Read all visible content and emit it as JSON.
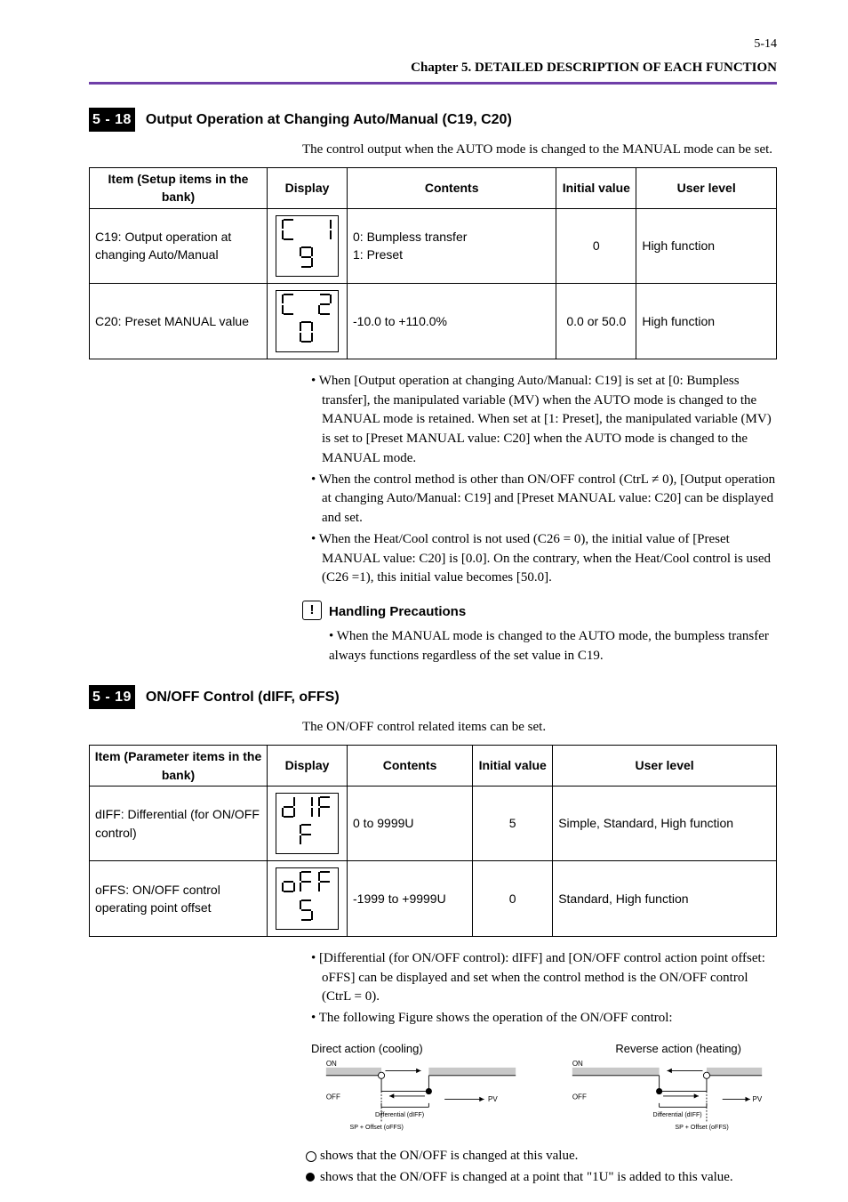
{
  "page_number": "5-14",
  "chapter": "Chapter 5.  DETAILED DESCRIPTION OF EACH FUNCTION",
  "section1": {
    "block": "5 - 18",
    "title": "Output Operation at Changing Auto/Manual (C19, C20)",
    "intro": "The control output when the AUTO mode is changed to the MANUAL mode can be set.",
    "th": [
      "Item (Setup items in the bank)",
      "Display",
      "Contents",
      "Initial value",
      "User level"
    ],
    "rows": [
      {
        "item": "C19: Output operation at changing Auto/Manual",
        "contents": "0: Bumpless transfer\n1: Preset",
        "init": "0",
        "user": "High function"
      },
      {
        "item": "C20: Preset MANUAL value",
        "contents": "-10.0 to +110.0%",
        "init": "0.0 or 50.0",
        "user": "High function"
      }
    ],
    "bullets": [
      "When [Output operation at changing Auto/Manual: C19] is set at [0: Bumpless transfer], the manipulated variable (MV) when the AUTO mode is changed to the MANUAL mode is retained. When set at [1: Preset], the manipulated variable (MV) is set to [Preset MANUAL value: C20] when the AUTO mode is changed to the MANUAL mode.",
      "When the control method is other than ON/OFF control (CtrL ≠ 0), [Output operation at changing Auto/Manual: C19] and [Preset MANUAL value: C20] can be displayed and set.",
      "When the Heat/Cool control is not used (C26 = 0), the initial value of [Preset MANUAL value: C20] is [0.0].  On the contrary, when the Heat/Cool control is used (C26 =1), this initial value becomes [50.0]."
    ],
    "note_label": "Handling Precautions",
    "note_body": "• When the MANUAL mode is changed to the AUTO mode, the bumpless transfer always functions regardless of the set value in C19."
  },
  "section2": {
    "block": "5 - 19",
    "title": "ON/OFF Control (dIFF, oFFS)",
    "intro": "The ON/OFF control related items can be set.",
    "th": [
      "Item (Parameter items in the bank)",
      "Display",
      "Contents",
      "Initial value",
      "User level"
    ],
    "rows": [
      {
        "item": "dIFF: Differential (for ON/OFF control)",
        "contents": "0 to 9999U",
        "init": "5",
        "user": "Simple, Standard, High function"
      },
      {
        "item": "oFFS: ON/OFF control operating point offset",
        "contents": "-1999 to +9999U",
        "init": "0",
        "user": "Standard, High function"
      }
    ],
    "bullets": [
      "[Differential (for ON/OFF control): dIFF] and [ON/OFF control action point offset: oFFS] can be displayed and set when the control method is the ON/OFF control (CtrL = 0).",
      "The following Figure shows the operation of the ON/OFF control:"
    ],
    "direct_left": "Direct action (cooling)",
    "direct_right": "Reverse action (heating)",
    "axis_labels": {
      "on": "ON",
      "off": "OFF",
      "diff": "Differential (dIFF)",
      "pv": "PV",
      "sp": "SP + Offset (oFFS)"
    },
    "legend_open": "shows that the ON/OFF is changed at this value.",
    "legend_fill": "shows that the ON/OFF is changed at a point that \"1U\" is added to this value."
  }
}
